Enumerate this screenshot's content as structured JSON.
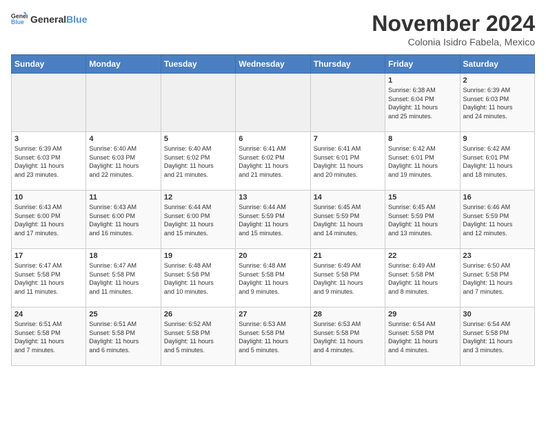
{
  "header": {
    "logo_general": "General",
    "logo_blue": "Blue",
    "month_title": "November 2024",
    "location": "Colonia Isidro Fabela, Mexico"
  },
  "days_of_week": [
    "Sunday",
    "Monday",
    "Tuesday",
    "Wednesday",
    "Thursday",
    "Friday",
    "Saturday"
  ],
  "weeks": [
    [
      {
        "day": "",
        "info": ""
      },
      {
        "day": "",
        "info": ""
      },
      {
        "day": "",
        "info": ""
      },
      {
        "day": "",
        "info": ""
      },
      {
        "day": "",
        "info": ""
      },
      {
        "day": "1",
        "info": "Sunrise: 6:38 AM\nSunset: 6:04 PM\nDaylight: 11 hours\nand 25 minutes."
      },
      {
        "day": "2",
        "info": "Sunrise: 6:39 AM\nSunset: 6:03 PM\nDaylight: 11 hours\nand 24 minutes."
      }
    ],
    [
      {
        "day": "3",
        "info": "Sunrise: 6:39 AM\nSunset: 6:03 PM\nDaylight: 11 hours\nand 23 minutes."
      },
      {
        "day": "4",
        "info": "Sunrise: 6:40 AM\nSunset: 6:03 PM\nDaylight: 11 hours\nand 22 minutes."
      },
      {
        "day": "5",
        "info": "Sunrise: 6:40 AM\nSunset: 6:02 PM\nDaylight: 11 hours\nand 21 minutes."
      },
      {
        "day": "6",
        "info": "Sunrise: 6:41 AM\nSunset: 6:02 PM\nDaylight: 11 hours\nand 21 minutes."
      },
      {
        "day": "7",
        "info": "Sunrise: 6:41 AM\nSunset: 6:01 PM\nDaylight: 11 hours\nand 20 minutes."
      },
      {
        "day": "8",
        "info": "Sunrise: 6:42 AM\nSunset: 6:01 PM\nDaylight: 11 hours\nand 19 minutes."
      },
      {
        "day": "9",
        "info": "Sunrise: 6:42 AM\nSunset: 6:01 PM\nDaylight: 11 hours\nand 18 minutes."
      }
    ],
    [
      {
        "day": "10",
        "info": "Sunrise: 6:43 AM\nSunset: 6:00 PM\nDaylight: 11 hours\nand 17 minutes."
      },
      {
        "day": "11",
        "info": "Sunrise: 6:43 AM\nSunset: 6:00 PM\nDaylight: 11 hours\nand 16 minutes."
      },
      {
        "day": "12",
        "info": "Sunrise: 6:44 AM\nSunset: 6:00 PM\nDaylight: 11 hours\nand 15 minutes."
      },
      {
        "day": "13",
        "info": "Sunrise: 6:44 AM\nSunset: 5:59 PM\nDaylight: 11 hours\nand 15 minutes."
      },
      {
        "day": "14",
        "info": "Sunrise: 6:45 AM\nSunset: 5:59 PM\nDaylight: 11 hours\nand 14 minutes."
      },
      {
        "day": "15",
        "info": "Sunrise: 6:45 AM\nSunset: 5:59 PM\nDaylight: 11 hours\nand 13 minutes."
      },
      {
        "day": "16",
        "info": "Sunrise: 6:46 AM\nSunset: 5:59 PM\nDaylight: 11 hours\nand 12 minutes."
      }
    ],
    [
      {
        "day": "17",
        "info": "Sunrise: 6:47 AM\nSunset: 5:58 PM\nDaylight: 11 hours\nand 11 minutes."
      },
      {
        "day": "18",
        "info": "Sunrise: 6:47 AM\nSunset: 5:58 PM\nDaylight: 11 hours\nand 11 minutes."
      },
      {
        "day": "19",
        "info": "Sunrise: 6:48 AM\nSunset: 5:58 PM\nDaylight: 11 hours\nand 10 minutes."
      },
      {
        "day": "20",
        "info": "Sunrise: 6:48 AM\nSunset: 5:58 PM\nDaylight: 11 hours\nand 9 minutes."
      },
      {
        "day": "21",
        "info": "Sunrise: 6:49 AM\nSunset: 5:58 PM\nDaylight: 11 hours\nand 9 minutes."
      },
      {
        "day": "22",
        "info": "Sunrise: 6:49 AM\nSunset: 5:58 PM\nDaylight: 11 hours\nand 8 minutes."
      },
      {
        "day": "23",
        "info": "Sunrise: 6:50 AM\nSunset: 5:58 PM\nDaylight: 11 hours\nand 7 minutes."
      }
    ],
    [
      {
        "day": "24",
        "info": "Sunrise: 6:51 AM\nSunset: 5:58 PM\nDaylight: 11 hours\nand 7 minutes."
      },
      {
        "day": "25",
        "info": "Sunrise: 6:51 AM\nSunset: 5:58 PM\nDaylight: 11 hours\nand 6 minutes."
      },
      {
        "day": "26",
        "info": "Sunrise: 6:52 AM\nSunset: 5:58 PM\nDaylight: 11 hours\nand 5 minutes."
      },
      {
        "day": "27",
        "info": "Sunrise: 6:53 AM\nSunset: 5:58 PM\nDaylight: 11 hours\nand 5 minutes."
      },
      {
        "day": "28",
        "info": "Sunrise: 6:53 AM\nSunset: 5:58 PM\nDaylight: 11 hours\nand 4 minutes."
      },
      {
        "day": "29",
        "info": "Sunrise: 6:54 AM\nSunset: 5:58 PM\nDaylight: 11 hours\nand 4 minutes."
      },
      {
        "day": "30",
        "info": "Sunrise: 6:54 AM\nSunset: 5:58 PM\nDaylight: 11 hours\nand 3 minutes."
      }
    ]
  ]
}
